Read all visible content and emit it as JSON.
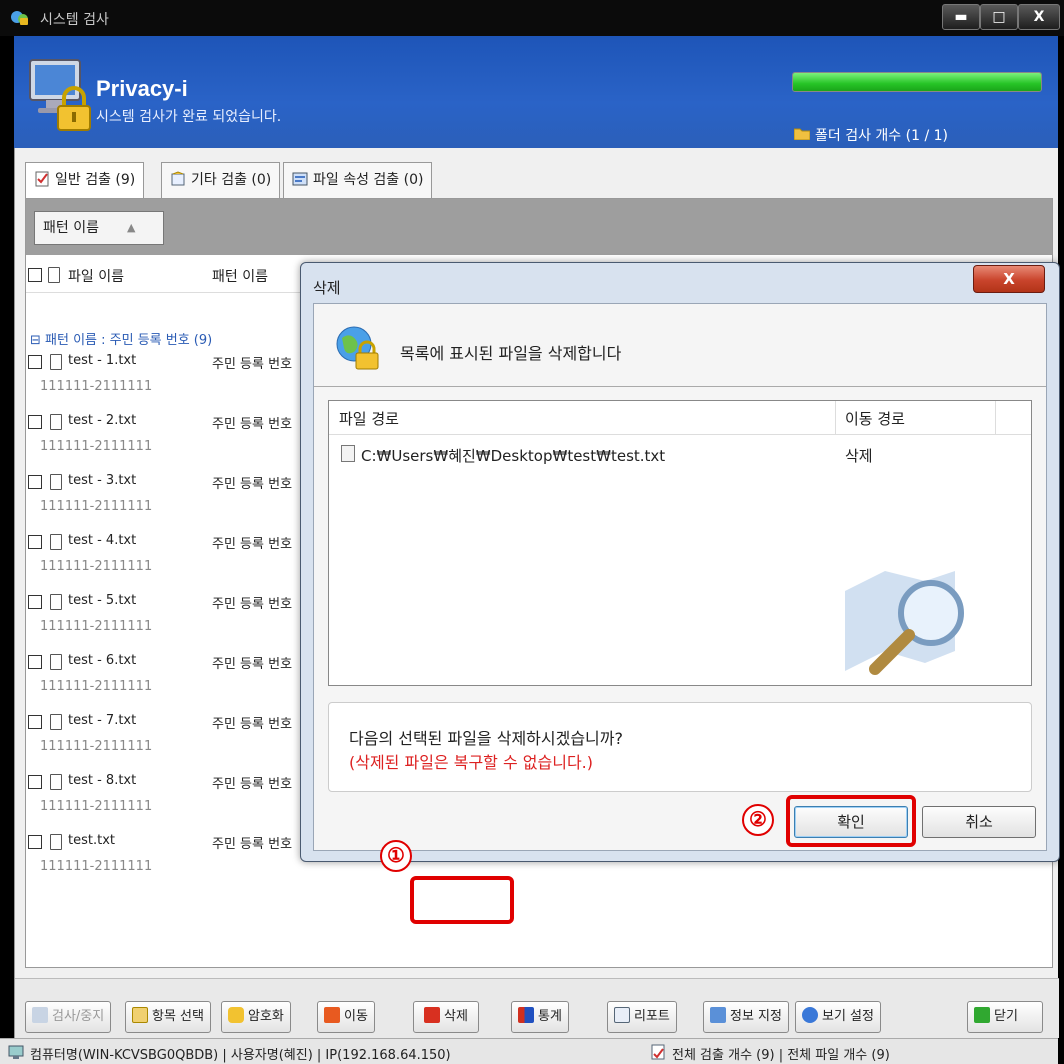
{
  "window": {
    "title": "시스템 검사",
    "min_glyph": "▬",
    "max_glyph": "□",
    "close_glyph": "X"
  },
  "header": {
    "app_name": "Privacy-i",
    "status": "시스템 검사가 완료 되었습니다.",
    "progress": 1.0,
    "folder_count": "폴더 검사 개수 (1 / 1)"
  },
  "tabs": [
    {
      "label": "일반 검출 (9)",
      "icon": "checklist-icon"
    },
    {
      "label": "기타 검출 (0)",
      "icon": "document-icon"
    },
    {
      "label": "파일 속성 검출 (0)",
      "icon": "file-properties-icon"
    }
  ],
  "group_bar": {
    "chip_label": "패턴 이름",
    "sort_glyph": "▲"
  },
  "columns": {
    "name": "파일 이름",
    "pattern": "패턴 이름"
  },
  "group_label": "⊟ 패턴 이름 : 주민 등록 번호 (9)",
  "rows": [
    {
      "name": "test - 1.txt",
      "pattern": "주민 등록 번호",
      "value": "111111-2111111"
    },
    {
      "name": "test - 2.txt",
      "pattern": "주민 등록 번호",
      "value": "111111-2111111"
    },
    {
      "name": "test - 3.txt",
      "pattern": "주민 등록 번호",
      "value": "111111-2111111"
    },
    {
      "name": "test - 4.txt",
      "pattern": "주민 등록 번호",
      "value": "111111-2111111"
    },
    {
      "name": "test - 5.txt",
      "pattern": "주민 등록 번호",
      "value": "111111-2111111"
    },
    {
      "name": "test - 6.txt",
      "pattern": "주민 등록 번호",
      "value": "111111-2111111"
    },
    {
      "name": "test - 7.txt",
      "pattern": "주민 등록 번호",
      "value": "111111-2111111"
    },
    {
      "name": "test - 8.txt",
      "pattern": "주민 등록 번호",
      "value": "111111-2111111"
    },
    {
      "name": "test.txt",
      "pattern": "주민 등록 번호",
      "value": "111111-2111111"
    }
  ],
  "toolbar": {
    "scan_stop": "검사/중지",
    "select_items": "항목 선택",
    "encrypt": "암호화",
    "move": "이동",
    "delete": "삭제",
    "stats": "통계",
    "report": "리포트",
    "info_set": "정보 지정",
    "view_settings": "보기 설정",
    "close": "닫기"
  },
  "statusbar": {
    "left": "컴퓨터명(WIN-KCVSBG0QBDB) | 사용자명(혜진) | IP(192.168.64.150)",
    "right": "전체 검출 개수 (9) | 전체 파일 개수 (9)"
  },
  "dialog": {
    "title": "삭제",
    "close_glyph": "X",
    "message": "목록에 표시된 파일을 삭제합니다",
    "list_headers": {
      "path": "파일 경로",
      "move": "이동 경로"
    },
    "list_rows": [
      {
        "path": "C:₩Users₩혜진₩Desktop₩test₩test.txt",
        "move": "삭제"
      }
    ],
    "question": "다음의 선택된 파일을 삭제하시겠습니까?",
    "warning": "(삭제된 파일은 복구할 수 없습니다.)",
    "ok": "확인",
    "cancel": "취소"
  },
  "annotations": {
    "marker1": "①",
    "marker2": "②"
  },
  "colors": {
    "header_blue": "#2a63c7",
    "annotation_red": "#e00000",
    "warning_red": "#d22222",
    "progress_green": "#26c426"
  }
}
